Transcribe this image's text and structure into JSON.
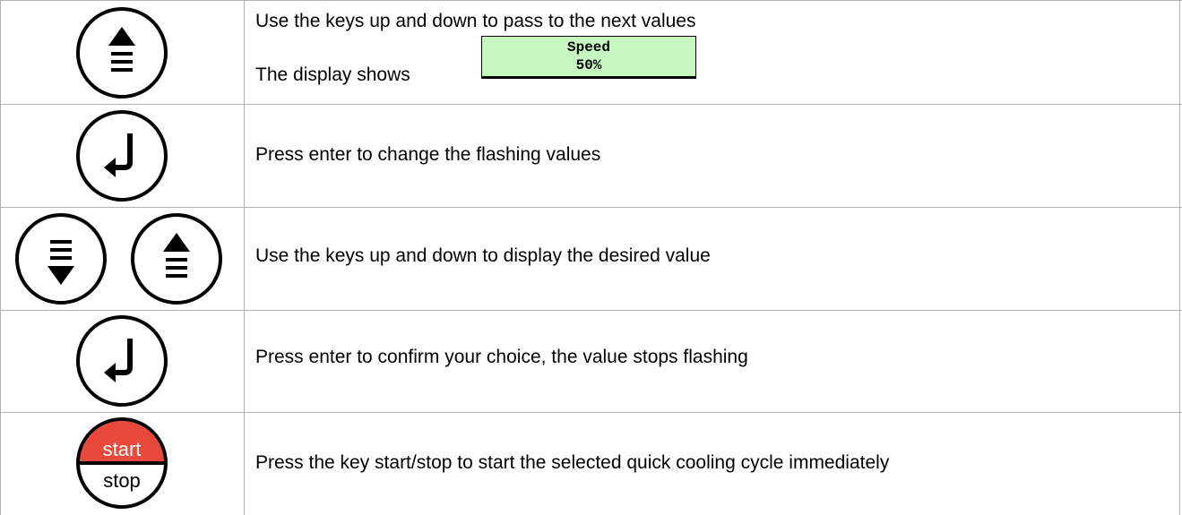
{
  "rows": [
    {
      "text": "Use the keys up and down to pass to the next values",
      "display_label": "The display shows",
      "display_line1": "Speed",
      "display_line2": "50%",
      "icon": "up-arrow-key-icon"
    },
    {
      "text": "Press enter to change the flashing values",
      "icon": "enter-key-icon"
    },
    {
      "text": "Use the keys up and down to display the desired value",
      "icons": [
        "down-arrow-key-icon",
        "up-arrow-key-icon"
      ]
    },
    {
      "text": "Press enter to confirm your choice, the value stops flashing",
      "icon": "enter-key-icon"
    },
    {
      "text": "Press the key start/stop to start the selected quick cooling cycle immediately",
      "icon": "start-stop-key-icon",
      "key_top_label": "start",
      "key_bottom_label": "stop"
    }
  ],
  "colors": {
    "grid": "#b0b0b0",
    "lcd_background": "#c6f7c0",
    "start_red": "#e8493a"
  }
}
